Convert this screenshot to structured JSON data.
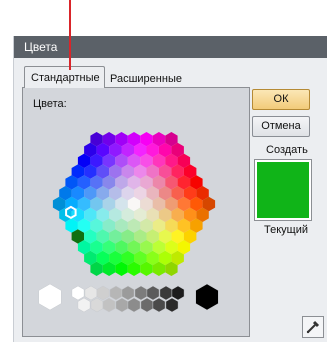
{
  "window": {
    "title": "Цвета"
  },
  "tabs": [
    {
      "label": "Стандартные",
      "active": true
    },
    {
      "label": "Расширенные",
      "active": false
    }
  ],
  "panel": {
    "colors_label": "Цвета:"
  },
  "buttons": {
    "ok": "ОК",
    "cancel": "Отмена"
  },
  "preview": {
    "new_label": "Создать",
    "current_label": "Текущий",
    "new_color": "#10b418"
  },
  "colors": {
    "accent_marker": "#d9252a",
    "ok_button": "#f2cb7a",
    "selected_hex": "#107010"
  },
  "icons": {
    "picker": "eyedropper-icon"
  }
}
